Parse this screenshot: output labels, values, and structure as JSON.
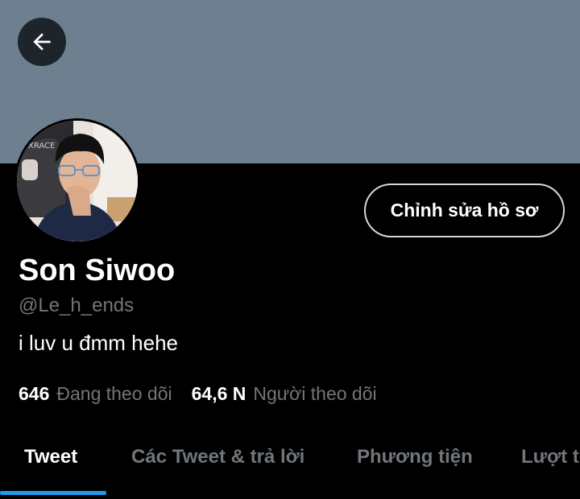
{
  "header": {
    "back_icon": "arrow-left-icon"
  },
  "profile": {
    "display_name": "Son Siwoo",
    "handle": "@Le_h_ends",
    "bio": "i luv u đmm hehe",
    "edit_button_label": "Chỉnh sửa hồ sơ"
  },
  "stats": {
    "following_count": "646",
    "following_label": "Đang theo dõi",
    "followers_count": "64,6 N",
    "followers_label": "Người theo dõi"
  },
  "tabs": [
    {
      "label": "Tweet",
      "active": true
    },
    {
      "label": "Các Tweet & trả lời",
      "active": false
    },
    {
      "label": "Phương tiện",
      "active": false
    },
    {
      "label": "Lượt thích",
      "active": false
    }
  ],
  "colors": {
    "banner": "#6e7f8f",
    "background": "#000000",
    "secondary_text": "#71767b",
    "accent": "#1d9bf0"
  }
}
